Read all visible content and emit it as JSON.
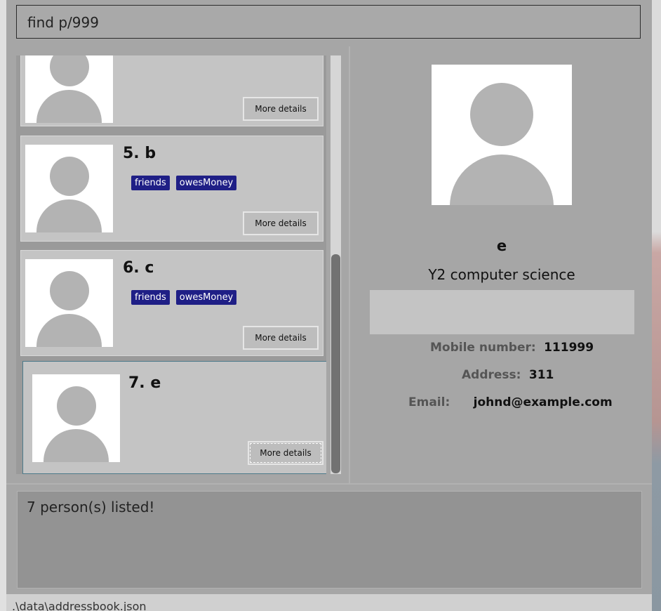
{
  "command": {
    "value": "find p/999"
  },
  "persons": [
    {
      "name": "",
      "tags": [],
      "button": "More details"
    },
    {
      "name": "5. b",
      "tags": [
        "friends",
        "owesMoney"
      ],
      "button": "More details"
    },
    {
      "name": "6. c",
      "tags": [
        "friends",
        "owesMoney"
      ],
      "button": "More details"
    },
    {
      "name": "7. e",
      "tags": [],
      "button": "More details"
    }
  ],
  "detail": {
    "name": "e",
    "course": "Y2 computer science",
    "mobile_label": "Mobile number:",
    "mobile": "111999",
    "address_label": "Address:",
    "address": "311",
    "email_label": "Email:",
    "email": "johnd@example.com"
  },
  "result": {
    "message": "7 person(s) listed!"
  },
  "status": {
    "path": ".\\data\\addressbook.json"
  },
  "colors": {
    "tag_bg": "#1f1f86",
    "selected_border": "#4c7a8a"
  }
}
